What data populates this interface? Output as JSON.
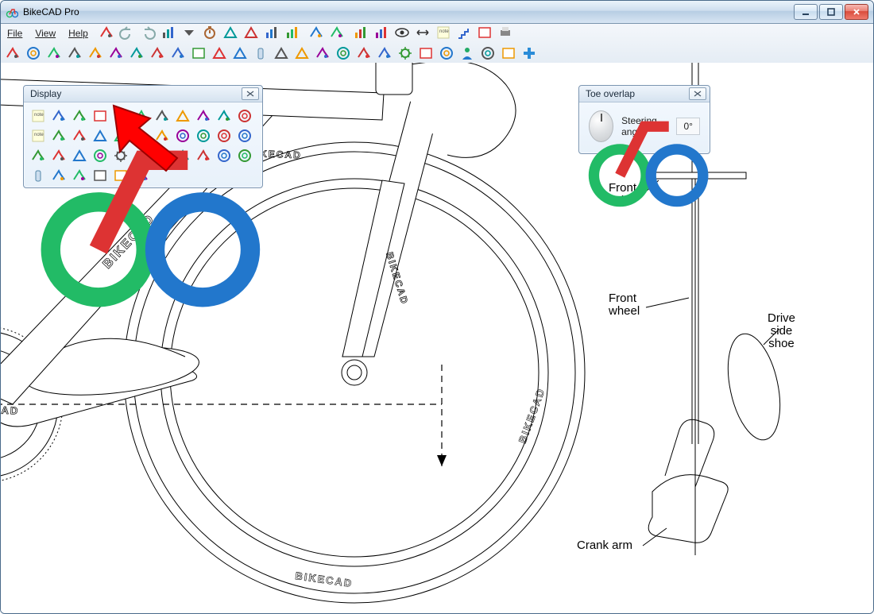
{
  "app": {
    "title": "BikeCAD Pro"
  },
  "menu": {
    "file": "File",
    "view": "View",
    "help": "Help"
  },
  "panels": {
    "display": {
      "title": "Display"
    },
    "toe": {
      "title": "Toe overlap",
      "steering_label": "Steering\nangle",
      "steering_value": "0°"
    }
  },
  "diagram": {
    "front_axle": "Front\naxle",
    "front_wheel": "Front\nwheel",
    "drive_side_shoe": "Drive\nside\nshoe",
    "crank_arm": "Crank arm",
    "bikecad": "BIKECAD"
  },
  "toolbar1": [
    "new-drawing-icon",
    "undo-icon",
    "redo-icon",
    "chart-icon",
    "dropdown-icon",
    "timer-icon",
    "frame-red-icon",
    "frame-blue-icon",
    "layers-icon",
    "tiles-icon",
    "sep",
    "brush-red-icon",
    "brush-blue-icon",
    "sep",
    "palette-icon",
    "spectrum-icon",
    "eye-icon",
    "dim-horizontal-icon",
    "note-icon",
    "stairs-icon",
    "page-icon",
    "print-icon"
  ],
  "toolbar2": [
    "bike-icon",
    "wheel-icon",
    "tool-icon",
    "crank-icon",
    "handlebar-icon",
    "headset-icon",
    "spacer-icon",
    "stem-icon",
    "stem2-icon",
    "box-blue-icon",
    "frame-outline-icon",
    "frame-cyan-icon",
    "bottle-icon",
    "triangle-icon",
    "triangle2-icon",
    "bracket-icon",
    "spring-icon",
    "caliper-icon",
    "caliper2-icon",
    "gear-icon",
    "card-icon",
    "ring-icon",
    "person-icon",
    "color-wheel-icon",
    "tv-icon",
    "plus-icon"
  ],
  "display_icons": [
    "note-icon",
    "chain-red-icon",
    "pants-icon",
    "blank-icon",
    "lock-icon",
    "paint-green-icon",
    "paint-red-icon",
    "frame-green-icon",
    "tool-gray-icon",
    "headset-icon",
    "ring-gray-icon",
    "note2-icon",
    "bolts-icon",
    "nuts-icon",
    "frame-blue2-icon",
    "frame-blue3-icon",
    "manifold-icon",
    "crank-dark-icon",
    "spring-gray-icon",
    "washer-icon",
    "washer2-icon",
    "seal-icon",
    "saddle-icon",
    "mount-icon",
    "triangle3-icon",
    "wheel2-icon",
    "derailleur-icon",
    "derailleur2-icon",
    "stem-gray-icon",
    "brush-icon",
    "brush2-icon",
    "bearing-icon",
    "ring2-icon",
    "bottle2-icon",
    "caliper3-icon",
    "caliper4-icon",
    "card2-icon",
    "card3-icon",
    "clip-icon"
  ]
}
